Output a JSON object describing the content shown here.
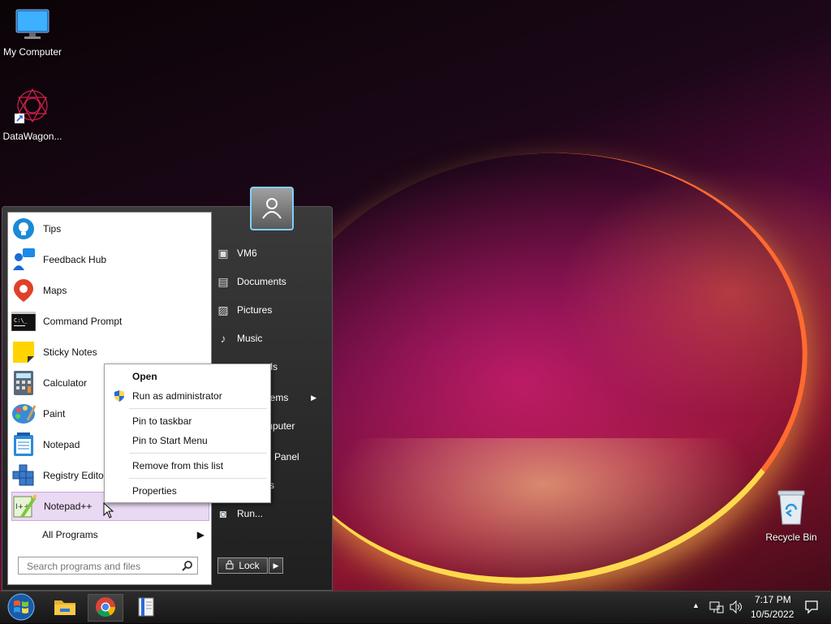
{
  "desktop": {
    "icons": [
      {
        "label": "My Computer"
      },
      {
        "label": "DataWagon..."
      },
      {
        "label": "Recycle Bin"
      }
    ]
  },
  "start_menu": {
    "programs": [
      {
        "label": "Tips",
        "icon": "lightbulb-icon"
      },
      {
        "label": "Feedback Hub",
        "icon": "feedback-icon"
      },
      {
        "label": "Maps",
        "icon": "map-pin-icon"
      },
      {
        "label": "Command Prompt",
        "icon": "terminal-icon"
      },
      {
        "label": "Sticky Notes",
        "icon": "sticky-note-icon"
      },
      {
        "label": "Calculator",
        "icon": "calculator-icon"
      },
      {
        "label": "Paint",
        "icon": "palette-icon"
      },
      {
        "label": "Notepad",
        "icon": "notepad-icon"
      },
      {
        "label": "Registry Editor",
        "icon": "registry-icon"
      },
      {
        "label": "Notepad++",
        "icon": "notepadpp-icon",
        "selected": true
      }
    ],
    "all_programs": "All Programs",
    "search_placeholder": "Search programs and files",
    "right_items": [
      {
        "label": "VM6",
        "icon": "user-folder-icon"
      },
      {
        "label": "Documents",
        "icon": "document-icon"
      },
      {
        "label": "Pictures",
        "icon": "picture-icon"
      },
      {
        "label": "Music",
        "icon": "music-icon"
      },
      {
        "label": "oads",
        "icon": "download-icon"
      },
      {
        "label": "Items",
        "icon": "items-icon",
        "submenu": true
      },
      {
        "label": "mputer",
        "icon": "computer-icon"
      },
      {
        "label": "l Panel",
        "icon": "control-panel-icon"
      },
      {
        "label": "s",
        "icon": "settings-icon"
      },
      {
        "label": "Run...",
        "icon": "run-icon"
      }
    ],
    "lock_label": "Lock"
  },
  "context_menu": {
    "items": [
      {
        "label": "Open",
        "bold": true
      },
      {
        "label": "Run as administrator",
        "icon": "shield-icon"
      },
      {
        "label": "Pin to taskbar"
      },
      {
        "label": "Pin to Start Menu"
      },
      {
        "label": "Remove from this list"
      },
      {
        "label": "Properties"
      }
    ]
  },
  "taskbar": {
    "apps": [
      {
        "name": "start-orb"
      },
      {
        "name": "file-explorer"
      },
      {
        "name": "chrome",
        "active": true
      },
      {
        "name": "app-book"
      }
    ],
    "clock_time": "7:17 PM",
    "clock_date": "10/5/2022"
  }
}
